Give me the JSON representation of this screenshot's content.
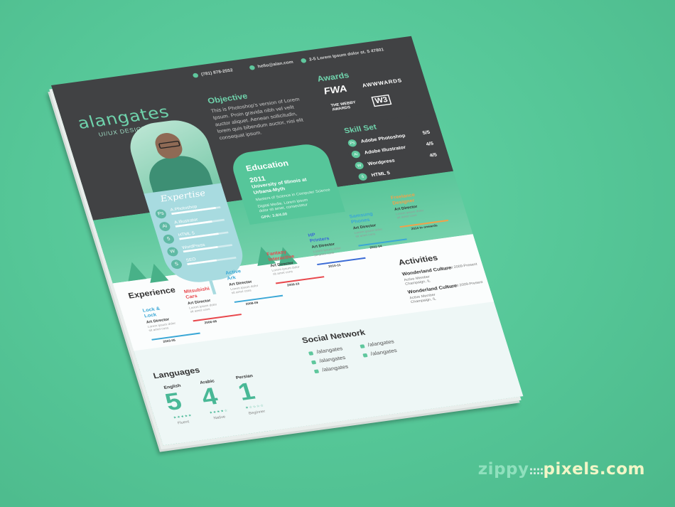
{
  "watermark": {
    "zippy": "zippy",
    "dots": "::::",
    "pixels": "pixels.com"
  },
  "resume": {
    "name": "alangates",
    "role": "UI/UX DESIGNER",
    "contact": {
      "phone": "(781) 878-2552",
      "email": "hello@alan.com",
      "address": "2-5 Lorem Ipsum dolor st. 5 47801"
    },
    "objective": {
      "heading": "Objective",
      "text": "This is Photoshop's version of Lorem Ipsum. Proin gravida nibh vel velit auctor aliquet. Aenean sollicitudin, lorem quis bibendum auctor, nisi elit consequat ipsum."
    },
    "awards": {
      "heading": "Awards",
      "logos": [
        "FWA",
        "AWWWARDS",
        "THE WEBBY AWARDS",
        "W3"
      ]
    },
    "expertise": {
      "heading": "Expertise",
      "items": [
        {
          "label": "A.Photoshop",
          "level": 0.9,
          "icon": "Ps"
        },
        {
          "label": "A.Illustrator",
          "level": 0.75,
          "icon": "Ai"
        },
        {
          "label": "HTML 5",
          "level": 0.8,
          "icon": "5"
        },
        {
          "label": "WordPress",
          "level": 0.7,
          "icon": "W"
        },
        {
          "label": "SEO",
          "level": 0.6,
          "icon": "S"
        }
      ]
    },
    "education": {
      "heading": "Education",
      "year": "2011",
      "school_1": "University of Illinois at",
      "school_2": "Urbana-Myth",
      "degree": "Masters of Science in Computer Science",
      "note_1": "Digital Media. Lorem ipsum",
      "note_2": "dolor sit amet, consectetur",
      "gpa": "GPA: 3.8/4.00"
    },
    "skillset": {
      "heading": "Skill Set",
      "items": [
        {
          "label": "Adobe Photoshop",
          "score": "5/5",
          "icon": "Ps"
        },
        {
          "label": "Adobe Illustrator",
          "score": "4/5",
          "icon": "Ai"
        },
        {
          "label": "Wordpress",
          "score": "4/5",
          "icon": "W"
        },
        {
          "label": "HTML 5",
          "score": "",
          "icon": "5"
        }
      ]
    },
    "experience": {
      "heading": "Experience",
      "jobs": [
        {
          "company_1": "Lock &",
          "company_2": "Lock",
          "role": "Art Director",
          "year": "2003-05",
          "color": "#3aa7d6"
        },
        {
          "company_1": "Mitsubishi",
          "company_2": "Cars",
          "role": "Art Director",
          "year": "2006-08",
          "color": "#e8474c"
        },
        {
          "company_1": "Active",
          "company_2": "Ark",
          "role": "Art Director",
          "year": "2008-09",
          "color": "#3aa7d6"
        },
        {
          "company_1": "Fantasy",
          "company_2": "Interactive",
          "role": "Art Director",
          "year": "2009-10",
          "color": "#e8474c"
        },
        {
          "company_1": "HP",
          "company_2": "Printers",
          "role": "Art Director",
          "year": "2010-11",
          "color": "#3a6bd6"
        },
        {
          "company_1": "Samsung",
          "company_2": "Phones",
          "role": "Art Director",
          "year": "2011-14",
          "color": "#3aa7d6"
        },
        {
          "company_1": "Freelance",
          "company_2": "Designer",
          "role": "Art Director",
          "year": "2014 to onwards",
          "color": "#f2a14a"
        }
      ],
      "desc_1": "Lorem ipsum dolor",
      "desc_2": "sit amet cons"
    },
    "activities": {
      "heading": "Activities",
      "items": [
        {
          "title": "Wonderland Culture",
          "role": "Active Member",
          "place": "Champaign, IL",
          "date": "August 2009-Present"
        },
        {
          "title": "Wonderland Culture",
          "role": "Active Member",
          "place": "Champaign, IL",
          "date": "August 2009-Present"
        }
      ]
    },
    "social": {
      "heading": "Social Network",
      "links": [
        {
          "icon": "f",
          "text": "/alangates"
        },
        {
          "icon": "in",
          "text": "/alangates"
        },
        {
          "icon": "t",
          "text": "/alangates"
        },
        {
          "icon": "b",
          "text": "/alangates"
        },
        {
          "icon": "v",
          "text": "/alangates"
        }
      ]
    },
    "languages": {
      "heading": "Languages",
      "items": [
        {
          "name": "English",
          "score": "5",
          "level": "Fluent",
          "stars": "★★★★★"
        },
        {
          "name": "Arabic",
          "score": "4",
          "level": "Native",
          "stars": "★★★★☆"
        },
        {
          "name": "Persian",
          "score": "1",
          "level": "Beginner",
          "stars": "★☆☆☆☆"
        }
      ]
    }
  }
}
